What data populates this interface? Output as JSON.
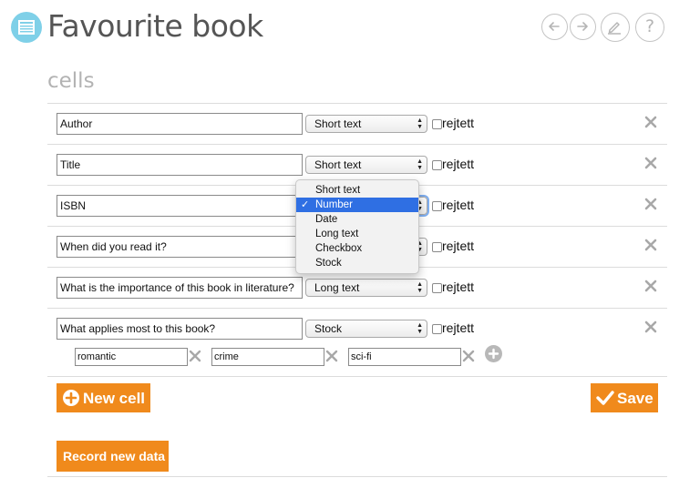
{
  "app": {
    "title": "Favourite book",
    "icon": "table-form-icon",
    "accent_color": "#7fd0e8"
  },
  "toolbar": {
    "buttons": [
      {
        "icon": "arrow-left-icon"
      },
      {
        "icon": "arrow-right-icon"
      },
      {
        "icon": "edit-icon"
      },
      {
        "icon": "help-icon",
        "label": "?"
      }
    ]
  },
  "section": {
    "heading": "cells"
  },
  "cells": [
    {
      "name": "Author",
      "type": "Short text",
      "hidden_label": "rejtett",
      "hidden_checked": false
    },
    {
      "name": "Title",
      "type": "Short text",
      "hidden_label": "rejtett",
      "hidden_checked": false
    },
    {
      "name": "ISBN",
      "type": "Number",
      "hidden_label": "rejtett",
      "hidden_checked": false
    },
    {
      "name": "When did you read it?",
      "type": "Date",
      "hidden_label": "rejtett",
      "hidden_checked": false
    },
    {
      "name": "What is the importance of this book in literature?",
      "type": "Long text",
      "hidden_label": "rejtett",
      "hidden_checked": false
    },
    {
      "name": "What applies most to this book?",
      "type": "Stock",
      "hidden_label": "rejtett",
      "hidden_checked": false
    }
  ],
  "stock_options": [
    "romantic",
    "crime",
    "sci-fi"
  ],
  "dropdown": {
    "options": [
      "Short text",
      "Number",
      "Date",
      "Long text",
      "Checkbox",
      "Stock"
    ],
    "selected": "Number",
    "check": "✓"
  },
  "buttons": {
    "new_cell": "New cell",
    "save": "Save",
    "record_new_data": "Record new data",
    "button_color": "#f08a1c"
  }
}
